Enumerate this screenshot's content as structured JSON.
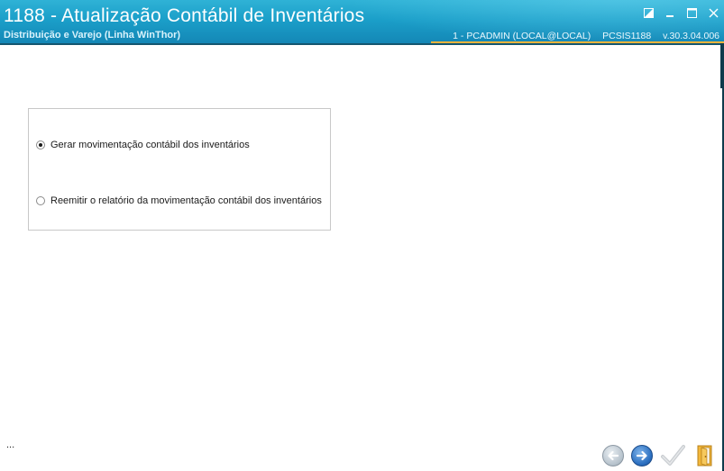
{
  "window": {
    "title": "1188 - Atualização Contábil de Inventários",
    "subtitle": "Distribuição e Varejo (Linha WinThor)",
    "status": {
      "user": "1 - PCADMIN (LOCAL@LOCAL)",
      "program": "PCSIS1188",
      "version": "v.30.3.04.006"
    },
    "controls": [
      "restore-icon",
      "minimize-icon",
      "maximize-icon",
      "close-icon"
    ]
  },
  "options": {
    "items": [
      {
        "label": "Gerar movimentação contábil dos inventários",
        "checked": true
      },
      {
        "label": "Reemitir o relatório da movimentação contábil dos inventários",
        "checked": false
      }
    ]
  },
  "footer": {
    "ellipsis": "...",
    "buttons": [
      "back-arrow-icon",
      "next-arrow-icon",
      "checkmark-icon",
      "exit-door-icon"
    ]
  },
  "colors": {
    "titlebar": "#1b9fc9",
    "status_underline": "#f2b43b",
    "next_button": "#2b6fc0"
  }
}
